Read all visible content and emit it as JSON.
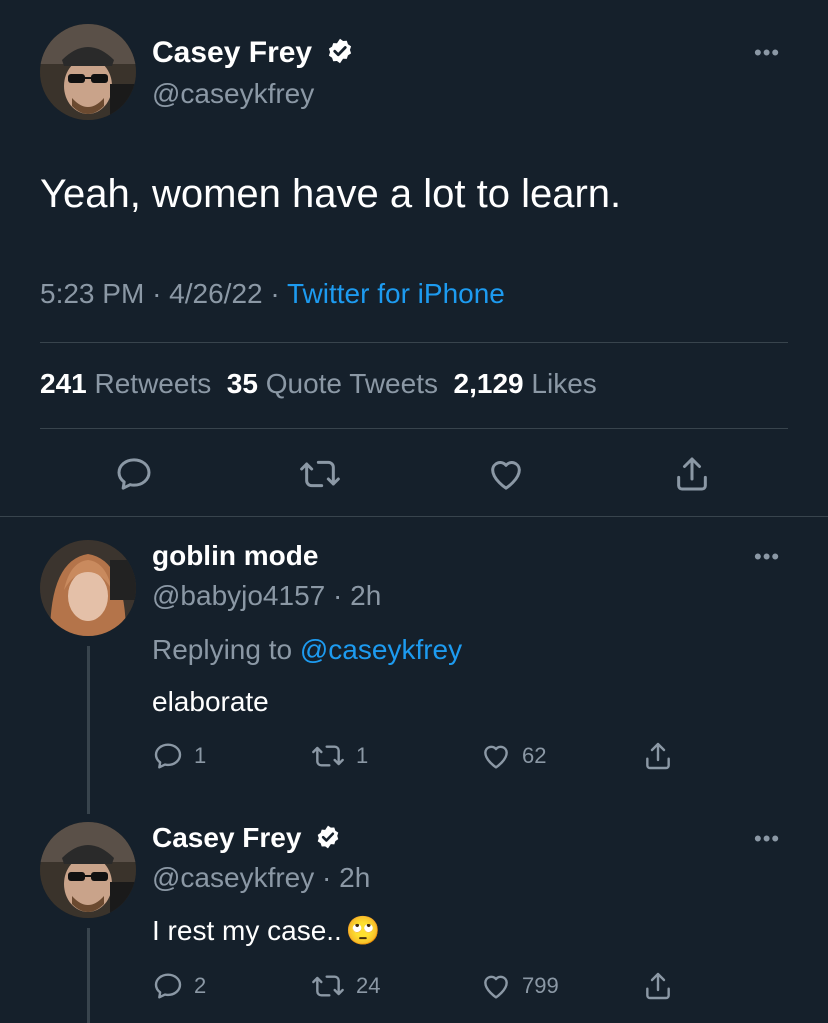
{
  "main_tweet": {
    "author_name": "Casey Frey",
    "author_handle": "@caseykfrey",
    "text": "Yeah, women have a lot to learn.",
    "time": "5:23 PM",
    "date": "4/26/22",
    "source": "Twitter for iPhone",
    "sep": "·",
    "stats": {
      "retweets_count": "241",
      "retweets_label": "Retweets",
      "quotes_count": "35",
      "quotes_label": "Quote Tweets",
      "likes_count": "2,129",
      "likes_label": "Likes"
    },
    "more": "•••"
  },
  "replies": [
    {
      "author_name": "goblin mode",
      "author_handle": "@babyjo4157",
      "age": "· 2h",
      "replying_to_label": "Replying to",
      "replying_to_handle": "@caseykfrey",
      "text": "elaborate",
      "reply_count": "1",
      "retweet_count": "1",
      "like_count": "62",
      "more": "•••"
    },
    {
      "author_name": "Casey Frey",
      "author_handle": "@caseykfrey",
      "age": "· 2h",
      "text": "I rest my case..",
      "emoji": "🙄",
      "reply_count": "2",
      "retweet_count": "24",
      "like_count": "799",
      "more": "•••"
    }
  ],
  "colors": {
    "background": "#15202b",
    "accent": "#1d9bf0",
    "muted": "#8b98a5",
    "divider": "#38444d"
  },
  "icons": [
    "reply-icon",
    "retweet-icon",
    "like-icon",
    "share-icon",
    "verified-icon",
    "more-icon"
  ]
}
